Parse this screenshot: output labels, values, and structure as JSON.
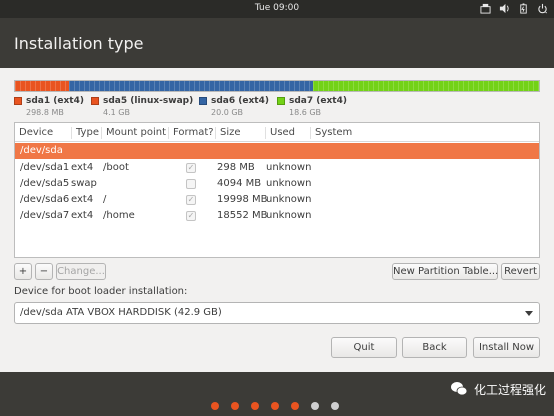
{
  "topbar": {
    "clock": "Tue 09:00",
    "icons": [
      "network-icon",
      "volume-icon",
      "battery-icon",
      "power-menu-icon"
    ]
  },
  "header": {
    "title": "Installation type"
  },
  "partition_bar": [
    {
      "label": "sda1 (ext4)",
      "size": "298.8 MB",
      "color": "#e95420",
      "fraction": 0.103
    },
    {
      "label": "sda5 (linux-swap)",
      "size": "4.1 GB",
      "color": "#e95420",
      "fraction": 0.0
    },
    {
      "label": "sda6 (ext4)",
      "size": "20.0 GB",
      "color": "#3465a4",
      "fraction": 0.466
    },
    {
      "label": "sda7 (ext4)",
      "size": "18.6 GB",
      "color": "#73d216",
      "fraction": 0.431
    }
  ],
  "table": {
    "columns": [
      "Device",
      "Type",
      "Mount point",
      "Format?",
      "Size",
      "Used",
      "System"
    ],
    "group": "/dev/sda",
    "rows": [
      {
        "device": "/dev/sda1",
        "type": "ext4",
        "mount": "/boot",
        "format": true,
        "size": "298 MB",
        "used": "unknown"
      },
      {
        "device": "/dev/sda5",
        "type": "swap",
        "mount": "",
        "format": false,
        "size": "4094 MB",
        "used": "unknown"
      },
      {
        "device": "/dev/sda6",
        "type": "ext4",
        "mount": "/",
        "format": true,
        "size": "19998 MB",
        "used": "unknown"
      },
      {
        "device": "/dev/sda7",
        "type": "ext4",
        "mount": "/home",
        "format": true,
        "size": "18552 MB",
        "used": "unknown"
      }
    ]
  },
  "buttons": {
    "add": "+",
    "remove": "−",
    "change": "Change...",
    "new_table": "New Partition Table...",
    "revert": "Revert",
    "quit": "Quit",
    "back": "Back",
    "install": "Install Now"
  },
  "boot_loader": {
    "label": "Device for boot loader installation:",
    "value": "/dev/sda   ATA VBOX HARDDISK (42.9 GB)"
  },
  "progress_dots": [
    "#e95420",
    "#e95420",
    "#e95420",
    "#e95420",
    "#e95420",
    "#cfcfcf",
    "#cfcfcf"
  ],
  "watermark": {
    "text": "化工过程强化"
  },
  "colors": {
    "accent": "#f07746",
    "background": "#f2f1f0",
    "chrome": "#3c3b37"
  }
}
